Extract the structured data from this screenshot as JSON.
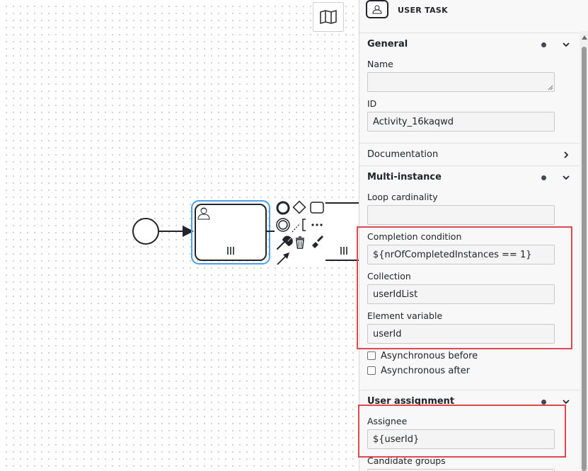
{
  "canvas": {
    "minimap_icon": "map-icon",
    "start_event_icon": "circle-icon",
    "user_task_icon": "user-icon",
    "multi_instance_marker": "parallel-marker-icon",
    "context_pad": {
      "end_event_icon": "bold-circle-icon",
      "gateway_icon": "diamond-icon",
      "task_icon": "rounded-rect-icon",
      "intermediate_event_icon": "double-circle-icon",
      "annotation_icon": "annotation-icon",
      "more_icon": "ellipsis-icon",
      "replace_icon": "wrench-icon",
      "delete_icon": "trash-icon",
      "color_icon": "paintbrush-icon",
      "connect_icon": "arrow-icon"
    }
  },
  "panel": {
    "header": {
      "type_label": "USER TASK",
      "icon": "user-task-icon"
    },
    "general": {
      "title": "General",
      "name_label": "Name",
      "name_value": "",
      "id_label": "ID",
      "id_value": "Activity_16kaqwd"
    },
    "documentation": {
      "title": "Documentation"
    },
    "multi_instance": {
      "title": "Multi-instance",
      "loop_cardinality_label": "Loop cardinality",
      "loop_cardinality_value": "",
      "completion_condition_label": "Completion condition",
      "completion_condition_value": "${nrOfCompletedInstances == 1}",
      "collection_label": "Collection",
      "collection_value": "userIdList",
      "element_variable_label": "Element variable",
      "element_variable_value": "userId",
      "async_before_label": "Asynchronous before",
      "async_after_label": "Asynchronous after"
    },
    "user_assignment": {
      "title": "User assignment",
      "assignee_label": "Assignee",
      "assignee_value": "${userId}",
      "candidate_groups_label": "Candidate groups"
    }
  },
  "colors": {
    "selection": "#4b9fe6",
    "highlight": "#e0484f",
    "stroke": "#22242a"
  }
}
